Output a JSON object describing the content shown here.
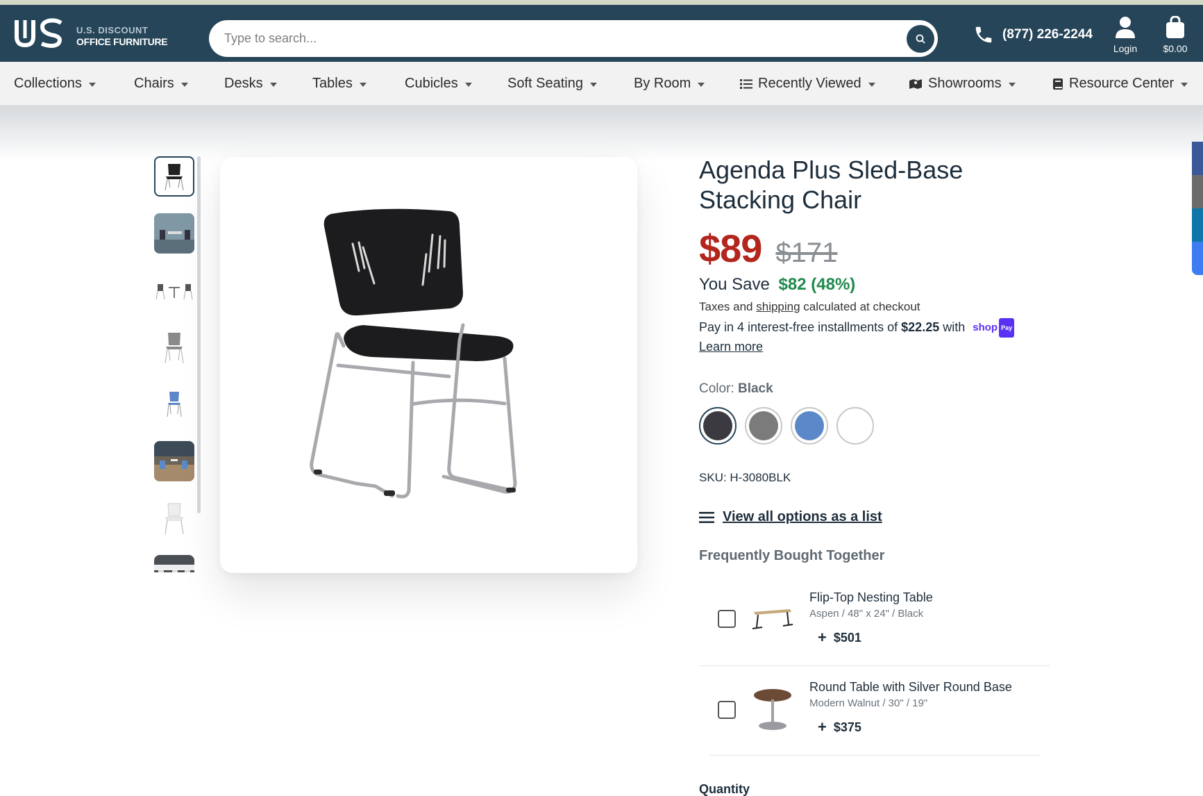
{
  "header": {
    "logo_line1": "U.S. DISCOUNT",
    "logo_line2": "OFFICE FURNITURE",
    "search_placeholder": "Type to search...",
    "phone": "(877) 226-2244",
    "login_label": "Login",
    "cart_label": "$0.00"
  },
  "nav": {
    "items": [
      {
        "label": "Collections"
      },
      {
        "label": "Chairs"
      },
      {
        "label": "Desks"
      },
      {
        "label": "Tables"
      },
      {
        "label": "Cubicles"
      },
      {
        "label": "Soft Seating"
      },
      {
        "label": "By Room"
      },
      {
        "label": "Recently Viewed",
        "icon": "list-icon"
      },
      {
        "label": "Showrooms",
        "icon": "map-icon"
      },
      {
        "label": "Resource Center",
        "icon": "book-icon"
      }
    ]
  },
  "product": {
    "title": "Agenda Plus Sled-Base Stacking Chair",
    "price": "$89",
    "compare_price": "$171",
    "save_label": "You Save",
    "save_amount": "$82 (48%)",
    "tax_prefix": "Taxes and",
    "tax_link": "shipping",
    "tax_suffix": "calculated at checkout",
    "installments_prefix": "Pay in 4 interest-free installments of",
    "installment_amount": "$22.25",
    "installments_with": "with",
    "shoppay_text": "shop",
    "shoppay_pill": "Pay",
    "learn_more": "Learn more",
    "color_label": "Color:",
    "color_value": "Black",
    "swatches": [
      {
        "name": "Black",
        "color": "#3a3a40",
        "selected": true
      },
      {
        "name": "Gray",
        "color": "#7b7b7b",
        "selected": false
      },
      {
        "name": "Blue",
        "color": "#5b88c9",
        "selected": false
      },
      {
        "name": "White",
        "color": "#ffffff",
        "selected": false
      }
    ],
    "sku": "SKU: H-3080BLK",
    "view_all": "View all options as a list"
  },
  "fbt": {
    "title": "Frequently Bought Together",
    "items": [
      {
        "name": "Flip-Top Nesting Table",
        "variant": "Aspen / 48\" x 24\" / Black",
        "price": "$501"
      },
      {
        "name": "Round Table with Silver Round Base",
        "variant": "Modern Walnut / 30\" / 19\"",
        "price": "$375"
      }
    ]
  },
  "quantity_label": "Quantity",
  "colors": {
    "header_bg": "#264559",
    "price_red": "#b3261e",
    "save_green": "#1e8a4c"
  }
}
